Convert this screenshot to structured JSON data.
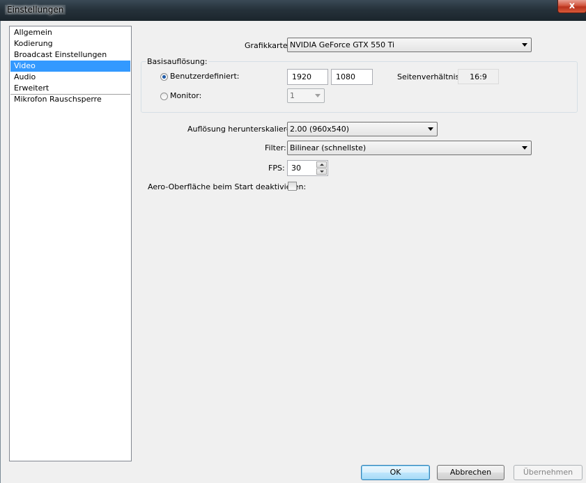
{
  "window": {
    "title": "Einstellungen",
    "close_glyph": "x"
  },
  "sidebar": {
    "items": [
      {
        "label": "Allgemein"
      },
      {
        "label": "Kodierung"
      },
      {
        "label": "Broadcast Einstellungen"
      },
      {
        "label": "Video",
        "selected": true
      },
      {
        "label": "Audio"
      },
      {
        "label": "Erweitert"
      },
      {
        "label": "Mikrofon Rauschsperre"
      }
    ]
  },
  "video": {
    "graphics_label": "Grafikkarte:",
    "graphics_value": "NVIDIA GeForce GTX 550 Ti",
    "base_group_label": "Basisauflösung:",
    "custom_label": "Benutzerdefiniert:",
    "custom_selected": true,
    "width_value": "1920",
    "height_value": "1080",
    "aspect_label": "Seitenverhältnis:",
    "aspect_value": "16:9",
    "monitor_label": "Monitor:",
    "monitor_value": "1",
    "downscale_label": "Auflösung herunterskalieren:",
    "downscale_value": "2.00  (960x540)",
    "filter_label": "Filter:",
    "filter_value": "Bilinear (schnellste)",
    "fps_label": "FPS:",
    "fps_value": "30",
    "aero_label": "Aero-Oberfläche beim Start deaktivieren:",
    "aero_checked": false
  },
  "buttons": {
    "ok": "OK",
    "cancel": "Abbrechen",
    "apply": "Übernehmen"
  },
  "icons": {
    "close": "close-icon",
    "dropdown": "chevron-down-icon",
    "spin_up": "arrow-up-icon",
    "spin_down": "arrow-down-icon"
  }
}
